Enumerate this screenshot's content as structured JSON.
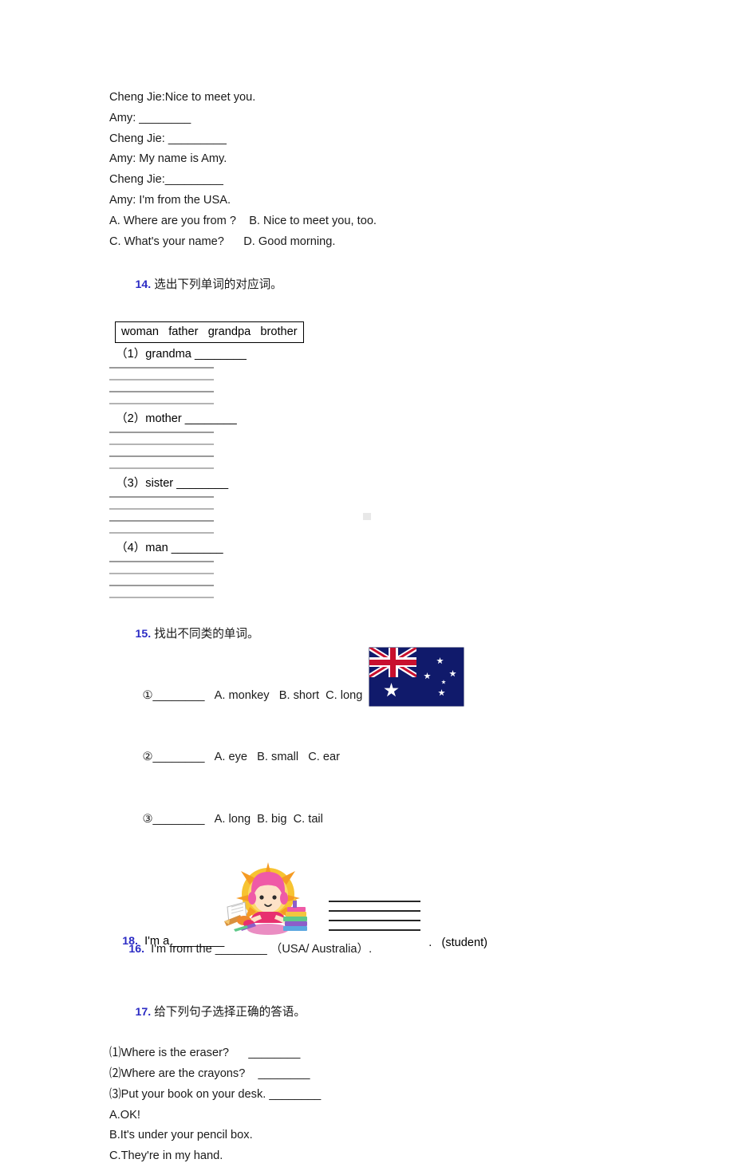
{
  "document": {
    "type": "english-worksheet",
    "accent_color": "#2b2bc4",
    "background": "#ffffff"
  },
  "dialogue": {
    "lines": [
      "Cheng Jie:Nice to meet you.",
      "Amy: ________",
      "Cheng Jie: _________",
      "Amy: My name is Amy.",
      "Cheng Jie:_________",
      "Amy: I'm from the USA.",
      "A. Where are you from ?    B. Nice to meet you, too.",
      "C. What's your name?      D. Good morning."
    ]
  },
  "q14": {
    "number": "14.",
    "prompt": "选出下列单词的对应词。",
    "wordbank": "woman   father   grandpa   brother",
    "items": [
      {
        "label": "（1）grandma ________"
      },
      {
        "label": "（2）mother ________"
      },
      {
        "label": "（3）sister ________"
      },
      {
        "label": "（4）man ________"
      }
    ],
    "rule_count": 4
  },
  "q15": {
    "number": "15.",
    "prompt": "找出不同类的单词。",
    "items": [
      {
        "marker": "①",
        "blank": "________",
        "options": "A. monkey   B. short  C. long"
      },
      {
        "marker": "②",
        "blank": "________",
        "options": "A. eye   B. small   C. ear"
      },
      {
        "marker": "③",
        "blank": "________",
        "options": "A. long  B. big  C. tail"
      }
    ]
  },
  "flag": {
    "name": "australian-flag",
    "field_color": "#101a6b",
    "cross_color": "#c8102e",
    "star_color": "#ffffff"
  },
  "q16": {
    "number": "16.",
    "text": "I'm from the ________ （USA/ Australia）."
  },
  "q17": {
    "number": "17.",
    "prompt": "给下列句子选择正确的答语。",
    "items": [
      "⑴Where is the eraser?      ________",
      "⑵Where are the crayons?    ________",
      "⑶Put your book on your desk. ________"
    ],
    "answers": [
      "A.OK!",
      "B.It's under your pencil box.",
      "C.They're in my hand."
    ]
  },
  "illustration": {
    "name": "girl-student-with-books",
    "hair_color": "#e8509c",
    "sun_color": "#f9b233",
    "dress_color": "#e8306f"
  },
  "q18": {
    "number": "18.",
    "text": "I'm a ________",
    "period": ".",
    "hint": "(student)",
    "write_line_count": 4
  }
}
